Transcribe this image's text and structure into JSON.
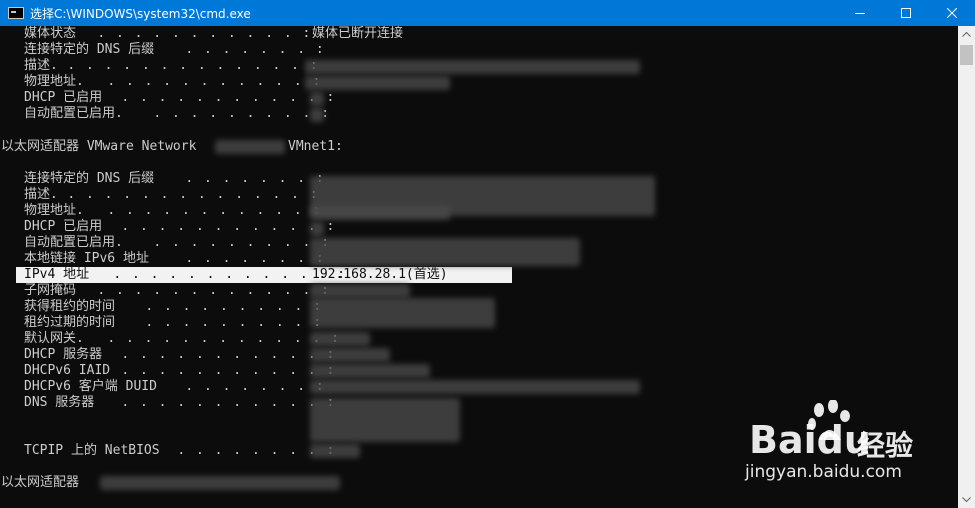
{
  "window": {
    "title": "选择C:\\WINDOWS\\system32\\cmd.exe",
    "icon": "cmd-icon",
    "controls": [
      "minimize",
      "maximize",
      "close"
    ]
  },
  "console": {
    "lines": [
      {
        "label": "媒体状态",
        "dots": " . . . . . . . . . . . :",
        "value": "媒体已断开连接"
      },
      {
        "label": "连接特定的 DNS 后缀",
        "dots": " . . . . . . . :",
        "value": ""
      },
      {
        "label": "描述.",
        "dots": " . . . . . . . . . . . . . :",
        "value": ""
      },
      {
        "label": "物理地址.",
        "dots": " . . . . . . . . . . . :",
        "value": ""
      },
      {
        "label": "DHCP 已启用",
        "dots": " . . . . . . . . . . . :",
        "value": ""
      },
      {
        "label": "自动配置已启用.",
        "dots": " . . . . . . . . . :",
        "value": ""
      },
      {
        "header": "以太网适配器 VMware Network",
        "header_tail": "VMnet1:"
      },
      {
        "label": "连接特定的 DNS 后缀",
        "dots": " . . . . . . . :",
        "value": ""
      },
      {
        "label": "描述.",
        "dots": " . . . . . . . . . . . . . :",
        "value": ""
      },
      {
        "label": "物理地址.",
        "dots": " . . . . . . . . . . . :",
        "value": ""
      },
      {
        "label": "DHCP 已启用",
        "dots": " . . . . . . . . . . . :",
        "value": ""
      },
      {
        "label": "自动配置已启用.",
        "dots": " . . . . . . . . . :",
        "value": ""
      },
      {
        "label": "本地链接 IPv6 地址",
        "dots": " . . . . . . . :",
        "value": ""
      },
      {
        "label": "IPv4 地址",
        "dots": " . . . . . . . . . . . . :",
        "value": "192.168.28.1(首选)"
      },
      {
        "label": "子网掩码",
        "dots": " . . . . . . . . . . . . :",
        "value": ""
      },
      {
        "label": "获得租约的时间",
        "dots": " . . . . . . . . . :",
        "value": ""
      },
      {
        "label": "租约过期的时间",
        "dots": " . . . . . . . . . :",
        "value": ""
      },
      {
        "label": "默认网关.",
        "dots": " . . . . . . . . . . . . :",
        "value": ""
      },
      {
        "label": "DHCP 服务器",
        "dots": " . . . . . . . . . . . :",
        "value": ""
      },
      {
        "label": "DHCPv6 IAID",
        "dots": " . . . . . . . . . . . :",
        "value": ""
      },
      {
        "label": "DHCPv6 客户端 DUID",
        "dots": " . . . . . . . :",
        "value": ""
      },
      {
        "label": "DNS 服务器",
        "dots": " . . . . . . . . . . . :",
        "value": ""
      },
      {
        "label": "TCPIP 上的 NetBIOS",
        "dots": " . . . . . . . . :",
        "value": ""
      },
      {
        "header": "以太网适配器",
        "header_tail": ""
      }
    ]
  },
  "watermark": {
    "brand": "Bai",
    "brand_tail": "du",
    "cn": "经验",
    "url": "jingyan.baidu.com"
  },
  "colors": {
    "titlebar": "#0078d7",
    "console_bg": "#0c0c0c",
    "console_text": "#cccccc",
    "selection_bg": "#f2f2f2"
  }
}
